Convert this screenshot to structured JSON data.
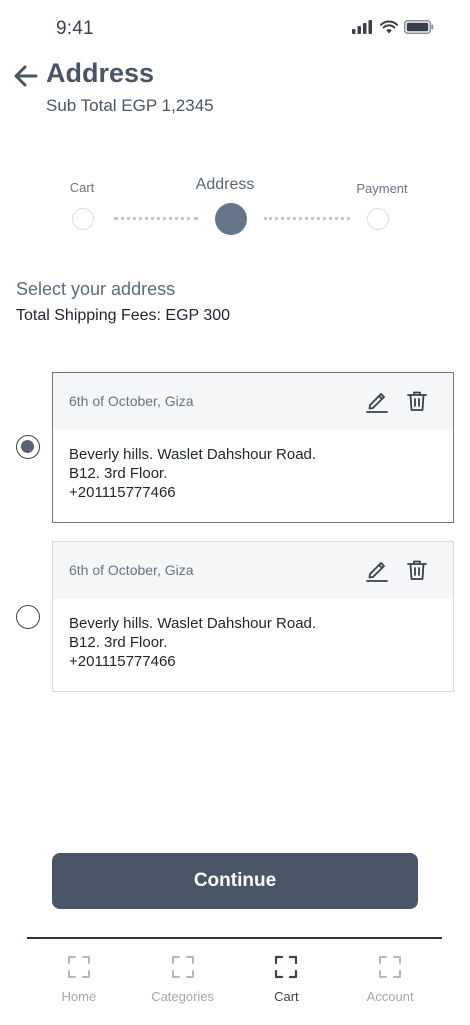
{
  "status_bar": {
    "time": "9:41"
  },
  "header": {
    "title": "Address",
    "subtotal": "Sub Total EGP 1,2345"
  },
  "stepper": {
    "steps": [
      {
        "label": "Cart"
      },
      {
        "label": "Address"
      },
      {
        "label": "Payment"
      }
    ],
    "active_step": "Address"
  },
  "address_section": {
    "title": "Select your address",
    "shipping_fees": "Total Shipping Fees: EGP 300"
  },
  "addresses": [
    {
      "city": "6th of October, Giza",
      "line1": "Beverly hills. Waslet Dahshour Road.",
      "line2": "B12. 3rd Floor.",
      "phone": "+201115777466",
      "selected": true
    },
    {
      "city": "6th of October, Giza",
      "line1": "Beverly hills. Waslet Dahshour Road.",
      "line2": "B12. 3rd Floor.",
      "phone": "+201115777466",
      "selected": false
    }
  ],
  "actions": {
    "continue_label": "Continue"
  },
  "bottom_nav": {
    "items": [
      {
        "label": "Home",
        "icon": "scan-frame-icon"
      },
      {
        "label": "Categories",
        "icon": "scan-frame-icon"
      },
      {
        "label": "Cart",
        "icon": "scan-frame-icon"
      },
      {
        "label": "Account",
        "icon": "scan-frame-icon"
      }
    ],
    "active": "Cart"
  },
  "colors": {
    "primary": "#4a5568",
    "active_step": "#66748a",
    "muted_text": "#6b7380",
    "card_header_bg": "#f5f6f8"
  }
}
